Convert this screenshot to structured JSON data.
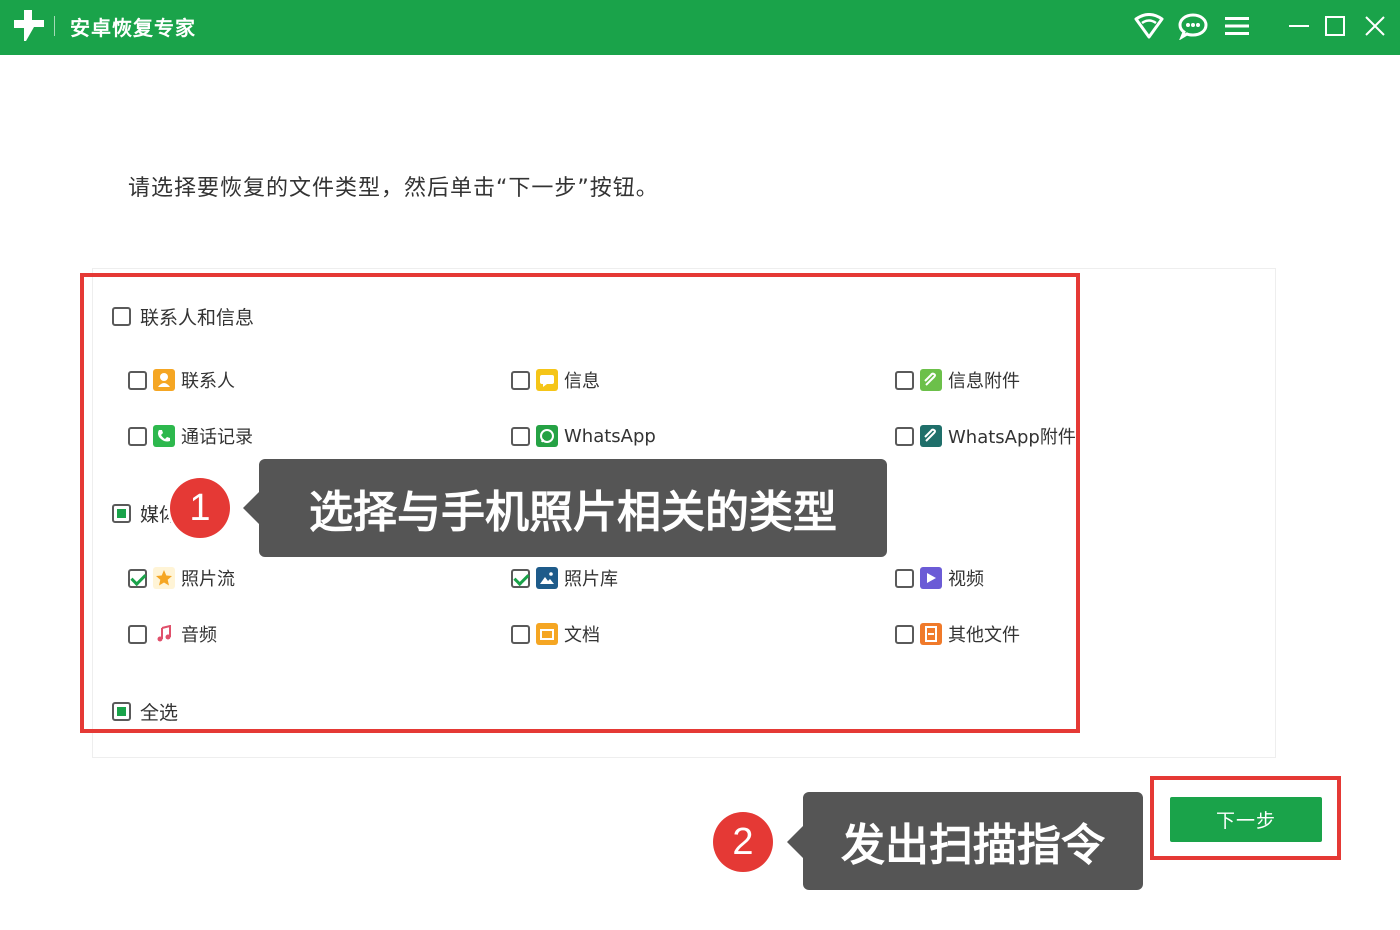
{
  "app": {
    "title": "安卓恢复专家"
  },
  "instruction": "请选择要恢复的文件类型，然后单击“下一步”按钮。",
  "categories": [
    {
      "label": "联系人和信息",
      "state": "unchecked",
      "items": [
        {
          "label": "联系人",
          "checked": false,
          "icon": "contact-icon",
          "color": "#f5a623"
        },
        {
          "label": "信息",
          "checked": false,
          "icon": "message-icon",
          "color": "#f5c518"
        },
        {
          "label": "信息附件",
          "checked": false,
          "icon": "attachment-icon",
          "color": "#6cc04a"
        },
        {
          "label": "通话记录",
          "checked": false,
          "icon": "phone-icon",
          "color": "#2db84d"
        },
        {
          "label": "WhatsApp",
          "checked": false,
          "icon": "whatsapp-icon",
          "color": "#25a244"
        },
        {
          "label": "WhatsApp附件",
          "checked": false,
          "icon": "whatsapp-attachment-icon",
          "color": "#1f6f6a"
        }
      ]
    },
    {
      "label": "媒体",
      "state": "partial",
      "items": [
        {
          "label": "照片流",
          "checked": true,
          "icon": "star-icon",
          "color": "#f5a623"
        },
        {
          "label": "照片库",
          "checked": true,
          "icon": "image-icon",
          "color": "#1e5b8a"
        },
        {
          "label": "视频",
          "checked": false,
          "icon": "video-icon",
          "color": "#6b5bd6"
        },
        {
          "label": "音频",
          "checked": false,
          "icon": "music-icon",
          "color": "#e0506b"
        },
        {
          "label": "文档",
          "checked": false,
          "icon": "folder-icon",
          "color": "#f5a623"
        },
        {
          "label": "其他文件",
          "checked": false,
          "icon": "file-icon",
          "color": "#f07a2a"
        }
      ]
    }
  ],
  "select_all": {
    "label": "全选",
    "state": "partial"
  },
  "callouts": [
    {
      "number": "1",
      "text": "选择与手机照片相关的类型"
    },
    {
      "number": "2",
      "text": "发出扫描指令"
    }
  ],
  "next_button": {
    "label": "下一步"
  },
  "colors": {
    "brand": "#1aa34a",
    "highlight": "#e53935",
    "callout_bg": "#555555"
  }
}
